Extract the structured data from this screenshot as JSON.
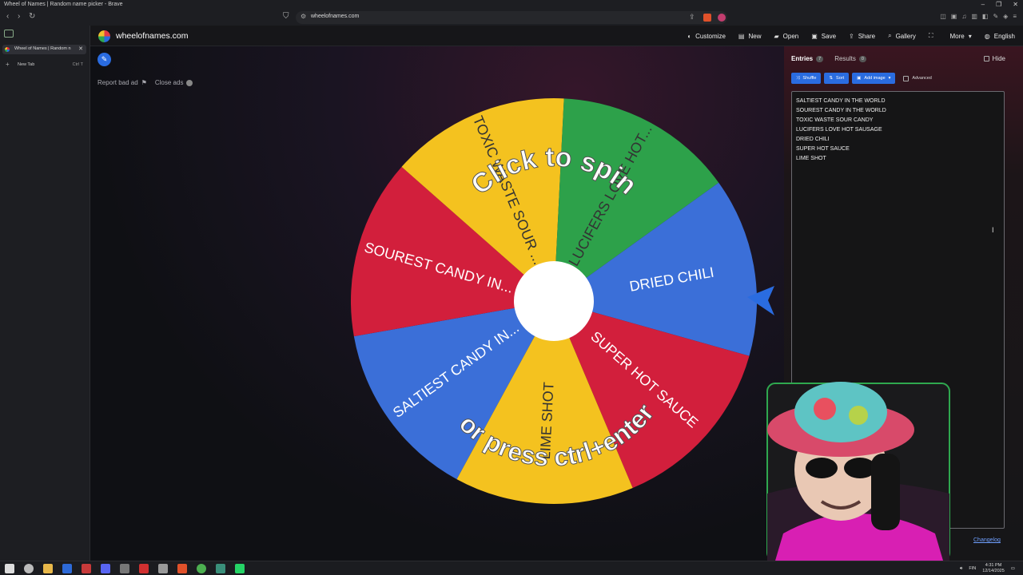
{
  "browser": {
    "window_title": "Wheel of Names | Random name picker - Brave",
    "url": "wheelofnames.com",
    "tab_title": "Wheel of Names | Random n",
    "new_tab_label": "New Tab",
    "new_tab_shortcut": "Ctrl T"
  },
  "app": {
    "site_name": "wheelofnames.com",
    "menu": [
      {
        "label": "Customize",
        "icon": "palette-icon"
      },
      {
        "label": "New",
        "icon": "file-icon"
      },
      {
        "label": "Open",
        "icon": "folder-icon"
      },
      {
        "label": "Save",
        "icon": "save-icon"
      },
      {
        "label": "Share",
        "icon": "share-icon"
      },
      {
        "label": "Gallery",
        "icon": "search-icon"
      },
      {
        "label": "",
        "icon": "fullscreen-icon"
      },
      {
        "label": "More",
        "icon": "chevron-down-icon"
      },
      {
        "label": "English",
        "icon": "globe-icon"
      }
    ],
    "report_bad_ad": "Report bad ad",
    "close_ads": "Close ads"
  },
  "wheel": {
    "slices": [
      {
        "label": "SALTIEST CANDY IN...",
        "color": "#3b6fd8"
      },
      {
        "label": "SOUREST CANDY IN...",
        "color": "#d21f3c"
      },
      {
        "label": "TOXIC WASTE SOUR ...",
        "color": "#f4c21f"
      },
      {
        "label": "LUCIFERS LOVE HOT...",
        "color": "#2da14a"
      },
      {
        "label": "DRIED CHILI",
        "color": "#3b6fd8"
      },
      {
        "label": "SUPER HOT SAUCE",
        "color": "#d21f3c"
      },
      {
        "label": "LIME SHOT",
        "color": "#f4c21f"
      }
    ],
    "cta_top": "Click to spin",
    "cta_bottom": "or press ctrl+enter",
    "pointer_color": "#2a6ce0"
  },
  "panel": {
    "tabs": [
      {
        "label": "Entries",
        "count": "7"
      },
      {
        "label": "Results",
        "count": "0"
      }
    ],
    "hide_label": "Hide",
    "buttons": {
      "shuffle": "Shuffle",
      "sort": "Sort",
      "add_image": "Add image"
    },
    "advanced_label": "Advanced",
    "entries": [
      "SALTIEST CANDY IN THE WORLD",
      "SOUREST CANDY IN THE WORLD",
      "TOXIC WASTE SOUR CANDY",
      "LUCIFERS LOVE HOT SAUSAGE",
      "DRIED CHILI",
      "SUPER HOT SAUCE",
      "LIME SHOT"
    ],
    "changelog": "Changelog"
  },
  "taskbar": {
    "language": "FIN",
    "time": "4:31 PM",
    "date": "12/14/2025"
  }
}
